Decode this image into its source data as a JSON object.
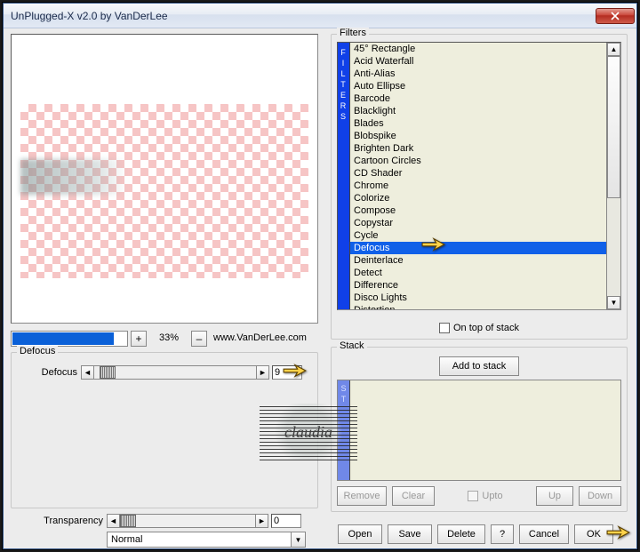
{
  "window": {
    "title": "UnPlugged-X v2.0 by VanDerLee"
  },
  "zoom": {
    "percent": "33%",
    "plus": "+",
    "minus": "–",
    "url": "www.VanDerLee.com"
  },
  "defocus": {
    "legend": "Defocus",
    "slider_label": "Defocus",
    "value": "9"
  },
  "transparency": {
    "label": "Transparency",
    "value": "0",
    "mode": "Normal"
  },
  "filters": {
    "legend": "Filters",
    "gutter": [
      "F",
      "I",
      "L",
      "T",
      "E",
      "R",
      "S"
    ],
    "items": [
      "45° Rectangle",
      "Acid Waterfall",
      "Anti-Alias",
      "Auto Ellipse",
      "Barcode",
      "Blacklight",
      "Blades",
      "Blobspike",
      "Brighten Dark",
      "Cartoon Circles",
      "CD Shader",
      "Chrome",
      "Colorize",
      "Compose",
      "Copystar",
      "Cycle",
      "Defocus",
      "Deinterlace",
      "Detect",
      "Difference",
      "Disco Lights",
      "Distortion"
    ],
    "selected_index": 16,
    "on_top_label": "On top of stack"
  },
  "stack": {
    "legend": "Stack",
    "gutter": [
      "S",
      "T"
    ],
    "add_label": "Add to stack",
    "remove": "Remove",
    "clear": "Clear",
    "upto": "Upto",
    "up": "Up",
    "down": "Down"
  },
  "buttons": {
    "open": "Open",
    "save": "Save",
    "delete": "Delete",
    "help": "?",
    "cancel": "Cancel",
    "ok": "OK"
  },
  "watermark": "claudia"
}
